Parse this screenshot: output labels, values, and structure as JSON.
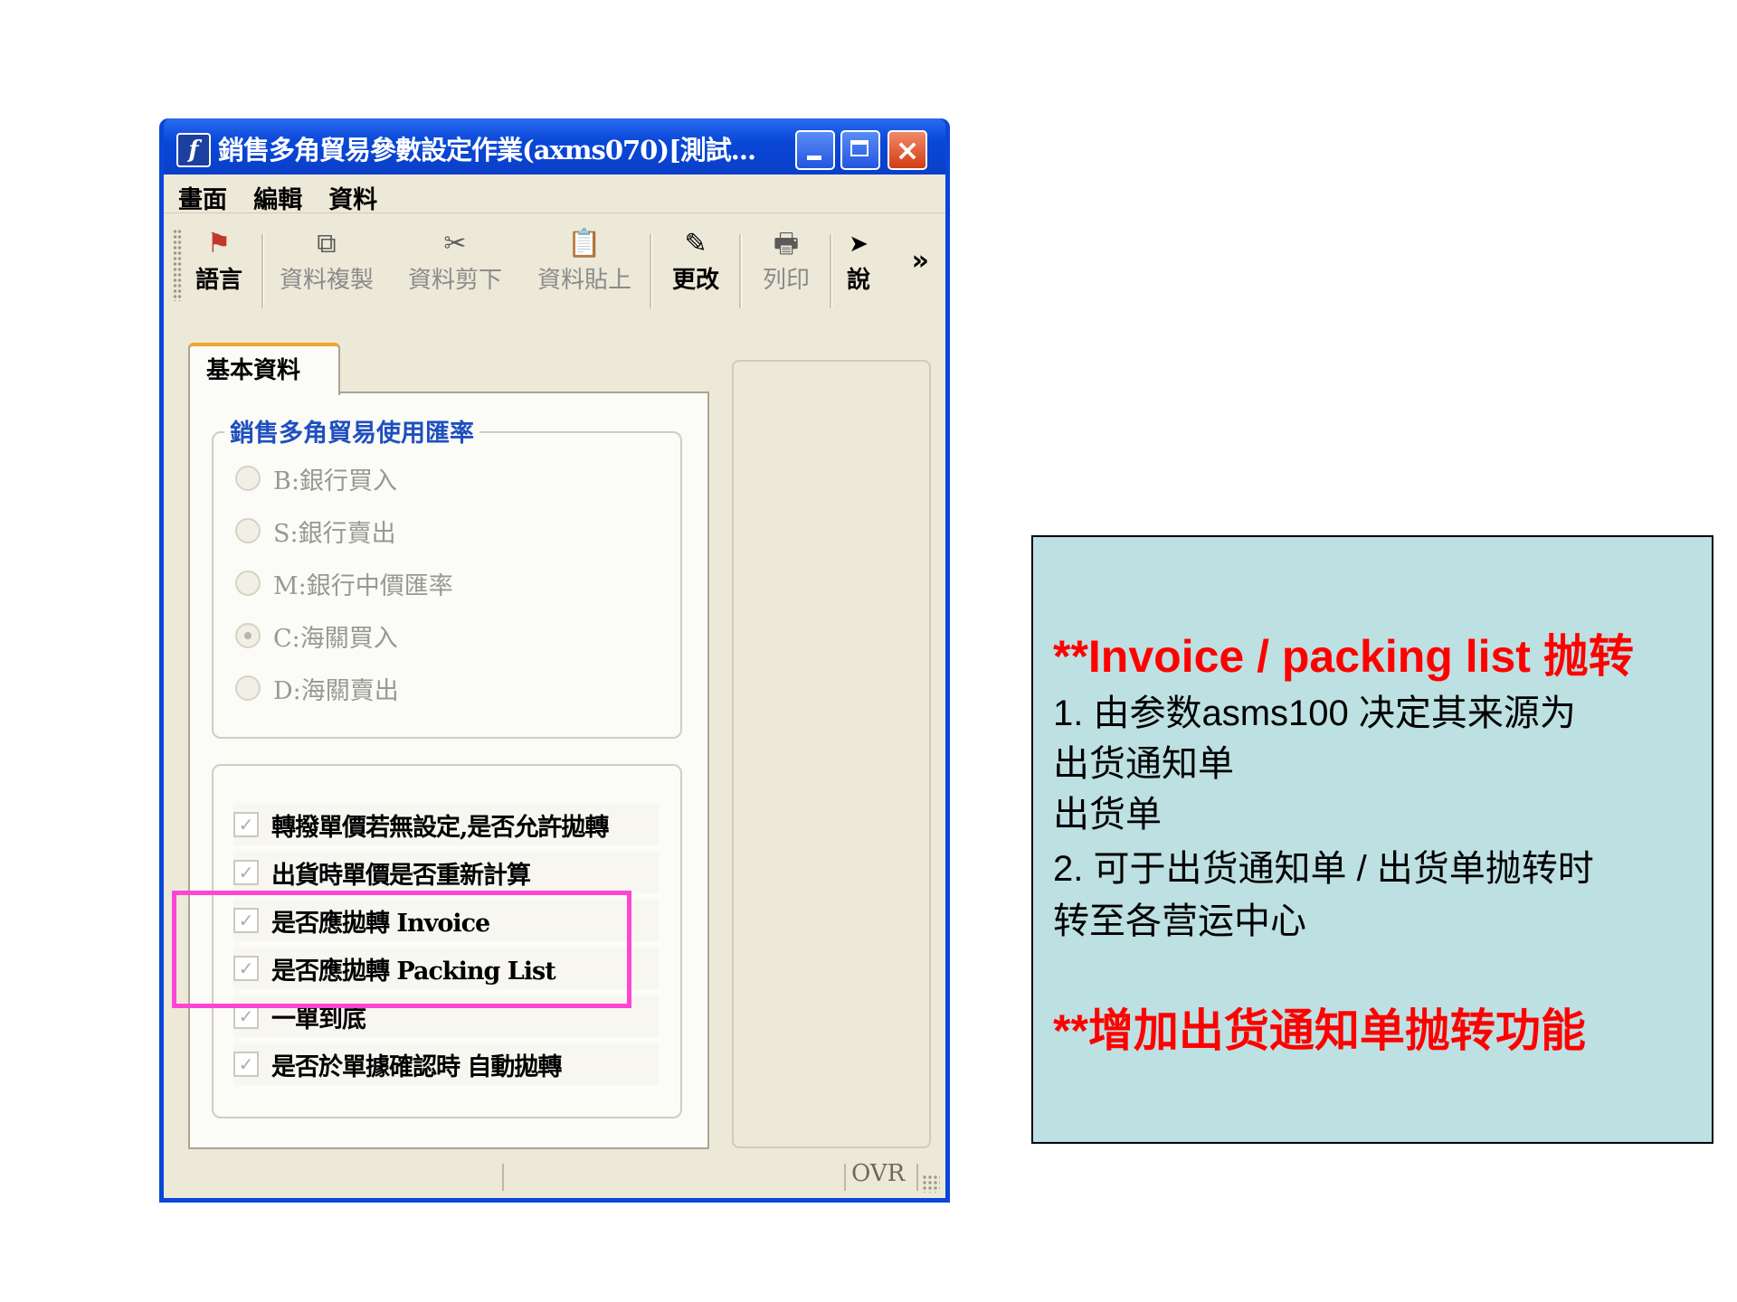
{
  "window": {
    "title": "銷售多角貿易參數設定作業(axms070)[測試...",
    "app_icon": "f",
    "controls": {
      "minimize": "minimize-icon",
      "maximize": "maximize-icon",
      "close": "×"
    }
  },
  "menu": [
    "畫面",
    "編輯",
    "資料"
  ],
  "toolbar": {
    "items": [
      {
        "label": "語言",
        "icon": "⚑",
        "enabled": true
      },
      {
        "label": "資料複製",
        "icon": "⧉",
        "enabled": false
      },
      {
        "label": "資料剪下",
        "icon": "✂",
        "enabled": false
      },
      {
        "label": "資料貼上",
        "icon": "📋",
        "enabled": false
      },
      {
        "label": "更改",
        "icon": "✎",
        "enabled": true
      },
      {
        "label": "列印",
        "icon": "🖶",
        "enabled": false
      },
      {
        "label": "說",
        "icon": "➤",
        "enabled": true
      }
    ],
    "overflow": "»"
  },
  "tab": {
    "label": "基本資料"
  },
  "rate_group": {
    "title": "銷售多角貿易使用匯率",
    "options": [
      {
        "label": "B:銀行買入",
        "selected": false
      },
      {
        "label": "S:銀行賣出",
        "selected": false
      },
      {
        "label": "M:銀行中價匯率",
        "selected": false
      },
      {
        "label": "C:海關買入",
        "selected": true
      },
      {
        "label": "D:海關賣出",
        "selected": false
      }
    ]
  },
  "checks": [
    {
      "label": "轉撥單價若無設定,是否允許拋轉",
      "checked": true
    },
    {
      "label": "出貨時單價是否重新計算",
      "checked": true
    },
    {
      "label": "是否應拋轉 Invoice",
      "checked": true
    },
    {
      "label": "是否應拋轉 Packing List",
      "checked": true
    },
    {
      "label": "一單到底",
      "checked": true
    },
    {
      "label": "是否於單據確認時 自動拋轉",
      "checked": true
    }
  ],
  "status": {
    "ovr": "OVR"
  },
  "highlight_color": "#ff45d3",
  "note": {
    "heading": "**Invoice / packing list 抛转",
    "line1": "1.  由参数asms100 决定其来源为",
    "line2": "出货通知单",
    "line3": "出货单",
    "line4": "2.  可于出货通知单 / 出货单抛转时",
    "line5": "转至各营运中心",
    "footer": "**增加出货通知单抛转功能",
    "background": "#bde0e2",
    "accent": "#ff0000"
  }
}
